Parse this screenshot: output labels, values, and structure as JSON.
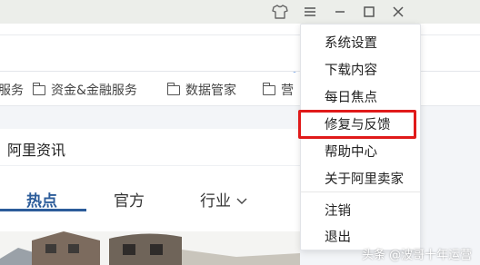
{
  "bookmarks": [
    {
      "label": "服务",
      "truncated": true
    },
    {
      "label": "资金&金融服务"
    },
    {
      "label": "数据管家"
    },
    {
      "label": "营"
    }
  ],
  "news": {
    "title": "阿里资讯",
    "tabs": [
      {
        "label": "热点",
        "active": true
      },
      {
        "label": "官方"
      },
      {
        "label": "行业"
      }
    ]
  },
  "menu": {
    "items": [
      {
        "label": "系统设置"
      },
      {
        "label": "下载内容"
      },
      {
        "label": "每日焦点"
      },
      {
        "label": "修复与反馈",
        "highlighted": true
      },
      {
        "label": "帮助中心"
      },
      {
        "label": "关于阿里卖家"
      },
      {
        "label": "注销"
      },
      {
        "label": "退出"
      }
    ]
  },
  "watermark": "头条 @波哥十年运营",
  "colors": {
    "accent": "#2c5c9a",
    "highlight": "#e01a1a"
  },
  "icons": [
    "shirt-icon",
    "hamburger-menu-icon",
    "minimize-icon",
    "maximize-icon",
    "close-icon",
    "folder-icon",
    "chevron-down-icon",
    "shield-icon"
  ]
}
